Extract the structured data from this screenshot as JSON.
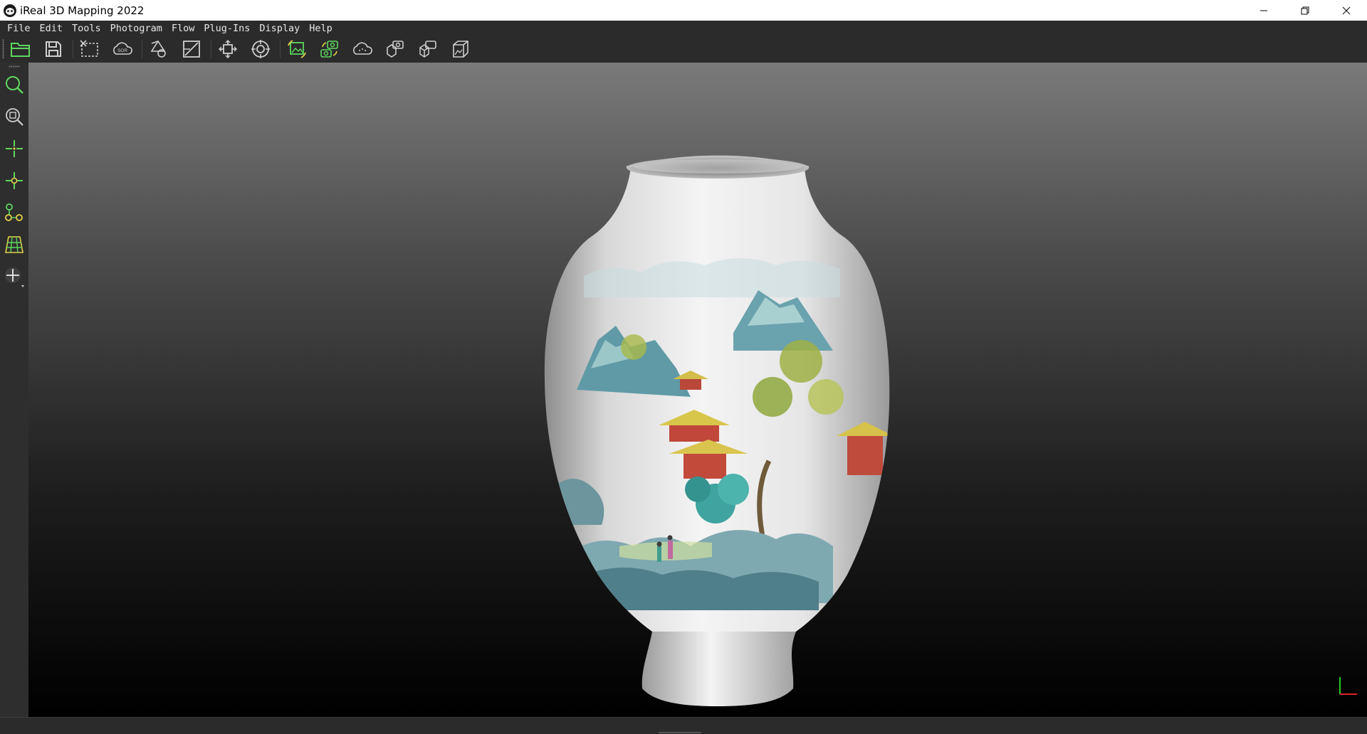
{
  "window": {
    "title": "iReal 3D Mapping 2022"
  },
  "menu": {
    "items": [
      "File",
      "Edit",
      "Tools",
      "Photogram",
      "Flow",
      "Plug-Ins",
      "Display",
      "Help"
    ]
  },
  "toolbar": {
    "icons": [
      "open-folder-icon",
      "save-icon",
      "crop-selection-icon",
      "sor-cloud-icon",
      "measure-tool-icon",
      "edit-area-icon",
      "move-transform-icon",
      "center-target-icon",
      "photo-align-icon",
      "camera-sync-icon",
      "point-cloud-icon",
      "capture-icon",
      "mesh-process-icon",
      "texture-model-icon"
    ],
    "sor_label": "SOR"
  },
  "sidebar": {
    "icons": [
      "zoom-icon",
      "zoom-fit-icon",
      "add-point-icon",
      "select-point-icon",
      "node-graph-icon",
      "grid-plane-icon",
      "pan-cross-icon"
    ]
  },
  "colors": {
    "accent_green": "#5fd65f",
    "accent_yellow": "#e6d24a",
    "chrome_dark": "#2b2b2b"
  }
}
